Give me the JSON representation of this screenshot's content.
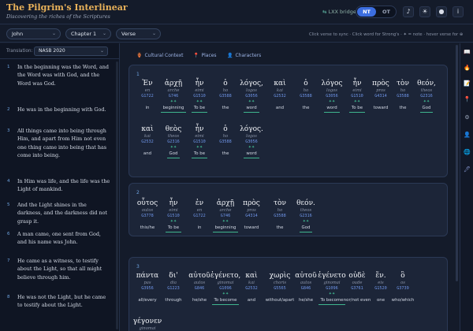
{
  "header": {
    "title": "The Pilgrim's Interlinear",
    "subtitle": "Discovering the riches of the Scriptures",
    "lxx_label": "LXX bridge",
    "testament_options": [
      "NT",
      "OT"
    ],
    "testament_selected": "NT",
    "icons": [
      "music-icon",
      "sun-icon",
      "user-icon",
      "info-icon"
    ]
  },
  "controls": {
    "book": "John",
    "chapter": "Chapter 1",
    "verse": "Verse",
    "hint": "Click verse to sync · Click word for Strong's · ✦ = note · hover verse for ⊕"
  },
  "left": {
    "translation_label": "Translation:",
    "translation": "NASB 2020",
    "verses": [
      {
        "n": "1",
        "text": "In the beginning was the Word, and the Word was with God, and the Word was God."
      },
      {
        "n": "2",
        "text": "He was in the beginning with God."
      },
      {
        "n": "3",
        "text": "All things came into being through Him, and apart from Him not even one thing came into being that has come into being."
      },
      {
        "n": "4",
        "text": "In Him was life, and the life was the Light of mankind."
      },
      {
        "n": "5",
        "text": "And the Light shines in the darkness, and the darkness did not grasp it."
      },
      {
        "n": "6",
        "text": "A man came, one sent from God, and his name was John."
      },
      {
        "n": "7",
        "text": "He came as a witness, to testify about the Light, so that all might believe through him."
      },
      {
        "n": "8",
        "text": "He was not the Light, but he came to testify about the Light."
      }
    ]
  },
  "main": {
    "tabs": [
      {
        "icon": "cultural-context-icon",
        "glyph": "🏺",
        "label": "Cultural Context"
      },
      {
        "icon": "places-icon",
        "glyph": "📍",
        "label": "Places"
      },
      {
        "icon": "characters-icon",
        "glyph": "👤",
        "label": "Characters"
      }
    ],
    "corner_verse": "1",
    "cards": [
      {
        "n": "1",
        "words": [
          {
            "g": "Ἐν",
            "tr": "en",
            "sn": "G1722",
            "pl": "",
            "en": "in",
            "u": false
          },
          {
            "g": "ἀρχῇ",
            "tr": "arche",
            "sn": "G746",
            "pl": "✦✦",
            "en": "beginning",
            "u": true
          },
          {
            "g": "ἦν",
            "tr": "eimi",
            "sn": "G1510",
            "pl": "✦✦",
            "en": "To be",
            "u": true
          },
          {
            "g": "ὁ",
            "tr": "ho",
            "sn": "G3588",
            "pl": "",
            "en": "the",
            "u": false
          },
          {
            "g": "λόγος,",
            "tr": "logos",
            "sn": "G3056",
            "pl": "✦✦",
            "en": "word",
            "u": true
          },
          {
            "g": "καὶ",
            "tr": "kai",
            "sn": "G2532",
            "pl": "",
            "en": "and",
            "u": false
          },
          {
            "g": "ὁ",
            "tr": "ho",
            "sn": "G3588",
            "pl": "",
            "en": "the",
            "u": false
          },
          {
            "g": "λόγος",
            "tr": "logos",
            "sn": "G3056",
            "pl": "✦✦",
            "en": "word",
            "u": true
          },
          {
            "g": "ἦν",
            "tr": "eimi",
            "sn": "G1510",
            "pl": "✦✦",
            "en": "To be",
            "u": true
          },
          {
            "g": "πρὸς",
            "tr": "pros",
            "sn": "G4314",
            "pl": "",
            "en": "toward",
            "u": false
          },
          {
            "g": "τὸν",
            "tr": "ho",
            "sn": "G3588",
            "pl": "",
            "en": "the",
            "u": false
          },
          {
            "g": "θεόν,",
            "tr": "theos",
            "sn": "G2316",
            "pl": "✦✦",
            "en": "God",
            "u": true
          },
          {
            "g": "καὶ",
            "tr": "kai",
            "sn": "G2532",
            "pl": "",
            "en": "and",
            "u": false
          },
          {
            "g": "θεὸς",
            "tr": "theos",
            "sn": "G2316",
            "pl": "✦✦",
            "en": "God",
            "u": true
          },
          {
            "g": "ἦν",
            "tr": "eimi",
            "sn": "G1510",
            "pl": "✦✦",
            "en": "To be",
            "u": true
          },
          {
            "g": "ὁ",
            "tr": "ho",
            "sn": "G3588",
            "pl": "",
            "en": "the",
            "u": false
          },
          {
            "g": "λόγος.",
            "tr": "logos",
            "sn": "G3056",
            "pl": "✦✦",
            "en": "word",
            "u": true
          }
        ]
      },
      {
        "n": "2",
        "words": [
          {
            "g": "οὗτος",
            "tr": "outos",
            "sn": "G3778",
            "pl": "",
            "en": "this/he",
            "u": false
          },
          {
            "g": "ἦν",
            "tr": "eimi",
            "sn": "G1510",
            "pl": "✦✦",
            "en": "To be",
            "u": true
          },
          {
            "g": "ἐν",
            "tr": "en",
            "sn": "G1722",
            "pl": "",
            "en": "in",
            "u": false
          },
          {
            "g": "ἀρχῇ",
            "tr": "arche",
            "sn": "G746",
            "pl": "✦✦",
            "en": "beginning",
            "u": true
          },
          {
            "g": "πρὸς",
            "tr": "pros",
            "sn": "G4314",
            "pl": "",
            "en": "toward",
            "u": false
          },
          {
            "g": "τὸν",
            "tr": "ho",
            "sn": "G3588",
            "pl": "",
            "en": "the",
            "u": false
          },
          {
            "g": "θεόν.",
            "tr": "theos",
            "sn": "G2316",
            "pl": "✦✦",
            "en": "God",
            "u": true
          }
        ]
      },
      {
        "n": "3",
        "words": [
          {
            "g": "πάντα",
            "tr": "pas",
            "sn": "G3956",
            "pl": "",
            "en": "all/every",
            "u": false
          },
          {
            "g": "δι'",
            "tr": "dia",
            "sn": "G1223",
            "pl": "",
            "en": "through",
            "u": false
          },
          {
            "g": "αὐτοῦ",
            "tr": "autos",
            "sn": "G846",
            "pl": "",
            "en": "he/she",
            "u": false
          },
          {
            "g": "ἐγένετο,",
            "tr": "ginomai",
            "sn": "G1096",
            "pl": "✦✦",
            "en": "To become",
            "u": true
          },
          {
            "g": "καὶ",
            "tr": "kai",
            "sn": "G2532",
            "pl": "",
            "en": "and",
            "u": false
          },
          {
            "g": "χωρὶς",
            "tr": "choris",
            "sn": "G5565",
            "pl": "",
            "en": "without/apart",
            "u": false
          },
          {
            "g": "αὐτοῦ",
            "tr": "autos",
            "sn": "G846",
            "pl": "",
            "en": "he/she",
            "u": false
          },
          {
            "g": "ἐγένετο",
            "tr": "ginomai",
            "sn": "G1096",
            "pl": "✦✦",
            "en": "To become",
            "u": true
          },
          {
            "g": "οὐδὲ",
            "tr": "oude",
            "sn": "G3761",
            "pl": "",
            "en": "nor/not even",
            "u": false
          },
          {
            "g": "ἕν.",
            "tr": "eis",
            "sn": "G1520",
            "pl": "",
            "en": "one",
            "u": false
          },
          {
            "g": "ὃ",
            "tr": "os",
            "sn": "G3739",
            "pl": "",
            "en": "who/which",
            "u": false
          },
          {
            "g": "γέγονεν",
            "tr": "ginomai",
            "sn": "",
            "pl": "",
            "en": "",
            "u": false
          }
        ]
      }
    ]
  },
  "rail_icons": [
    {
      "name": "book-icon",
      "glyph": "📖"
    },
    {
      "name": "flame-icon",
      "glyph": "🔥"
    },
    {
      "name": "notes-icon",
      "glyph": "📝"
    },
    {
      "name": "pin-icon",
      "glyph": "📍"
    },
    {
      "name": "settings-icon",
      "glyph": "⚙"
    },
    {
      "name": "person-icon",
      "glyph": "👤"
    },
    {
      "name": "globe-icon",
      "glyph": "🌐"
    },
    {
      "name": "pen-icon",
      "glyph": "🖊"
    }
  ]
}
